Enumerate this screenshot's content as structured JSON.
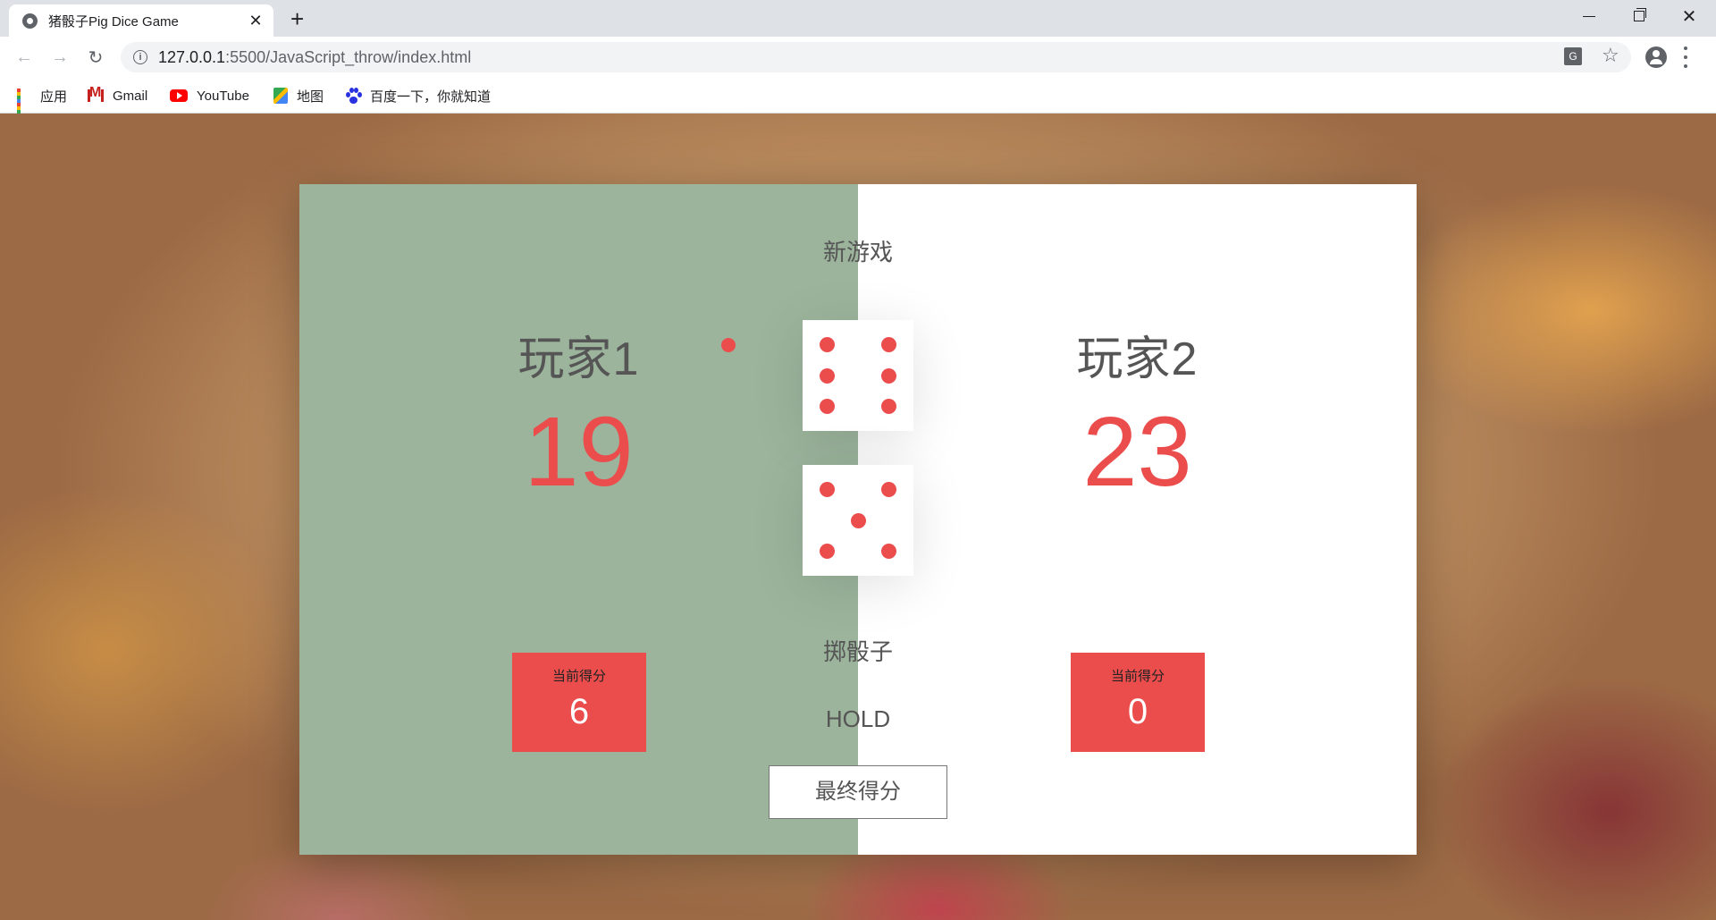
{
  "browser": {
    "tab_title": "猪骰子Pig Dice Game",
    "new_tab": "+",
    "url_host": "127.0.0.1",
    "url_rest": ":5500/JavaScript_throw/index.html",
    "bookmarks": [
      {
        "label": "应用",
        "icon": "apps-icon"
      },
      {
        "label": "Gmail",
        "icon": "gmail-icon"
      },
      {
        "label": "YouTube",
        "icon": "youtube-icon"
      },
      {
        "label": "地图",
        "icon": "maps-icon"
      },
      {
        "label": "百度一下，你就知道",
        "icon": "baidu-icon"
      }
    ]
  },
  "game": {
    "new_game": "新游戏",
    "roll_dice": "掷骰子",
    "hold": "HOLD",
    "final_score": "最终得分",
    "active_player": 1,
    "dice": [
      6,
      5
    ],
    "players": [
      {
        "name": "玩家1",
        "score": "19",
        "current_label": "当前得分",
        "current_score": "6"
      },
      {
        "name": "玩家2",
        "score": "23",
        "current_label": "当前得分",
        "current_score": "0"
      }
    ],
    "colors": {
      "accent": "#eb4d4d",
      "active_panel": "#9cb49c",
      "inactive_panel": "#ffffff"
    }
  }
}
